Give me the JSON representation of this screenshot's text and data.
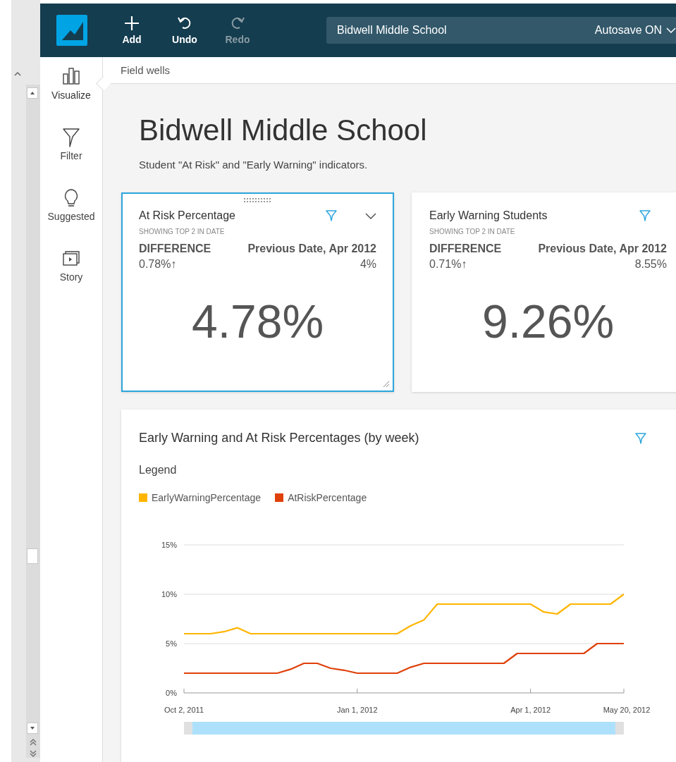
{
  "toolbar": {
    "buttons": [
      {
        "kind": "add",
        "label": "Add",
        "disabled": false
      },
      {
        "kind": "undo",
        "label": "Undo",
        "disabled": false
      },
      {
        "kind": "redo",
        "label": "Redo",
        "disabled": true
      }
    ],
    "analysis_name": "Bidwell Middle School",
    "autosave": "Autosave ON"
  },
  "sidebar": {
    "items": [
      {
        "kind": "visualize",
        "label": "Visualize",
        "selected": true
      },
      {
        "kind": "filter",
        "label": "Filter",
        "selected": false
      },
      {
        "kind": "suggested",
        "label": "Suggested",
        "selected": false
      },
      {
        "kind": "story",
        "label": "Story",
        "selected": false
      }
    ]
  },
  "field_wells": "Field wells",
  "sheet": {
    "title": "Bidwell Middle School",
    "subtitle": "Student \"At Risk\" and \"Early Warning\" indicators."
  },
  "kpis": [
    {
      "title": "At Risk Percentage",
      "subtitle": "SHOWING TOP 2 IN DATE",
      "diff_label": "DIFFERENCE",
      "diff_value": "0.78%↑",
      "prev_label": "Previous Date, Apr 2012",
      "prev_value": "4%",
      "value": "4.78%",
      "selected": true
    },
    {
      "title": "Early Warning Students",
      "subtitle": "SHOWING TOP 2 IN DATE",
      "diff_label": "DIFFERENCE",
      "diff_value": "0.71%↑",
      "prev_label": "Previous Date, Apr 2012",
      "prev_value": "8.55%",
      "value": "9.26%",
      "selected": false
    }
  ],
  "chart_card": {
    "title": "Early Warning and At Risk Percentages (by week)",
    "legend_title": "Legend",
    "chart_data": {
      "type": "line",
      "categories": [
        "Oct 2, 2011",
        null,
        null,
        null,
        null,
        null,
        null,
        null,
        null,
        null,
        null,
        null,
        null,
        "Jan 1, 2012",
        null,
        null,
        null,
        null,
        null,
        null,
        null,
        null,
        null,
        null,
        null,
        null,
        "Apr 1, 2012",
        null,
        null,
        null,
        null,
        null,
        null,
        "May 20, 2012"
      ],
      "series": [
        {
          "name": "EarlyWarningPercentage",
          "color": "#ffb500",
          "values": [
            6,
            6,
            6,
            6.2,
            6.6,
            6,
            6,
            6,
            6,
            6,
            6,
            6,
            6,
            6,
            6,
            6,
            6,
            6.8,
            7.4,
            9,
            9,
            9,
            9,
            9,
            9,
            9,
            9,
            8.2,
            8,
            9,
            9,
            9,
            9,
            10
          ]
        },
        {
          "name": "AtRiskPercentage",
          "color": "#e0400a",
          "values": [
            2,
            2,
            2,
            2,
            2,
            2,
            2,
            2,
            2.4,
            3,
            3,
            2.5,
            2.3,
            2,
            2,
            2,
            2,
            2.6,
            3,
            3,
            3,
            3,
            3,
            3,
            3,
            4,
            4,
            4,
            4,
            4,
            4,
            5,
            5,
            5
          ]
        }
      ],
      "ylim": [
        0,
        15
      ],
      "yticks": [
        {
          "value": 0,
          "label": "0%"
        },
        {
          "value": 5,
          "label": "5%"
        },
        {
          "value": 10,
          "label": "10%"
        },
        {
          "value": 15,
          "label": "15%"
        }
      ]
    }
  }
}
